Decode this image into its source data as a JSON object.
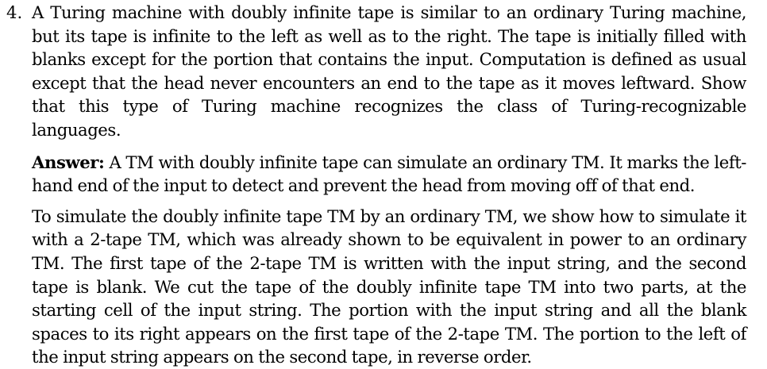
{
  "problem": {
    "number": "4.",
    "text": "A Turing machine with doubly infinite tape is similar to an ordinary Turing machine, but its tape is infinite to the left as well as to the right. The tape is initially filled with blanks except for the portion that contains the input. Computation is defined as usual except that the head never encounters an end to the tape as it moves leftward. Show that this type of Turing machine recognizes the class of Turing-recognizable languages."
  },
  "answer": {
    "label": "Answer:",
    "paragraph1": "A TM with doubly infinite tape can simulate an ordinary TM. It marks the left-hand end of the input to detect and prevent the head from moving off of that end.",
    "paragraph2": "To simulate the doubly infinite tape TM by an ordinary TM, we show how to simulate it with a 2-tape TM, which was already shown to be equivalent in power to an ordinary TM. The first tape of the 2-tape TM is written with the input string, and the second tape is blank. We cut the tape of the doubly infinite tape TM into two parts, at the starting cell of the input string. The portion with the input string and all the blank spaces to its right appears on the first tape of the 2-tape TM. The portion to the left of the input string appears on the second tape, in reverse order."
  }
}
